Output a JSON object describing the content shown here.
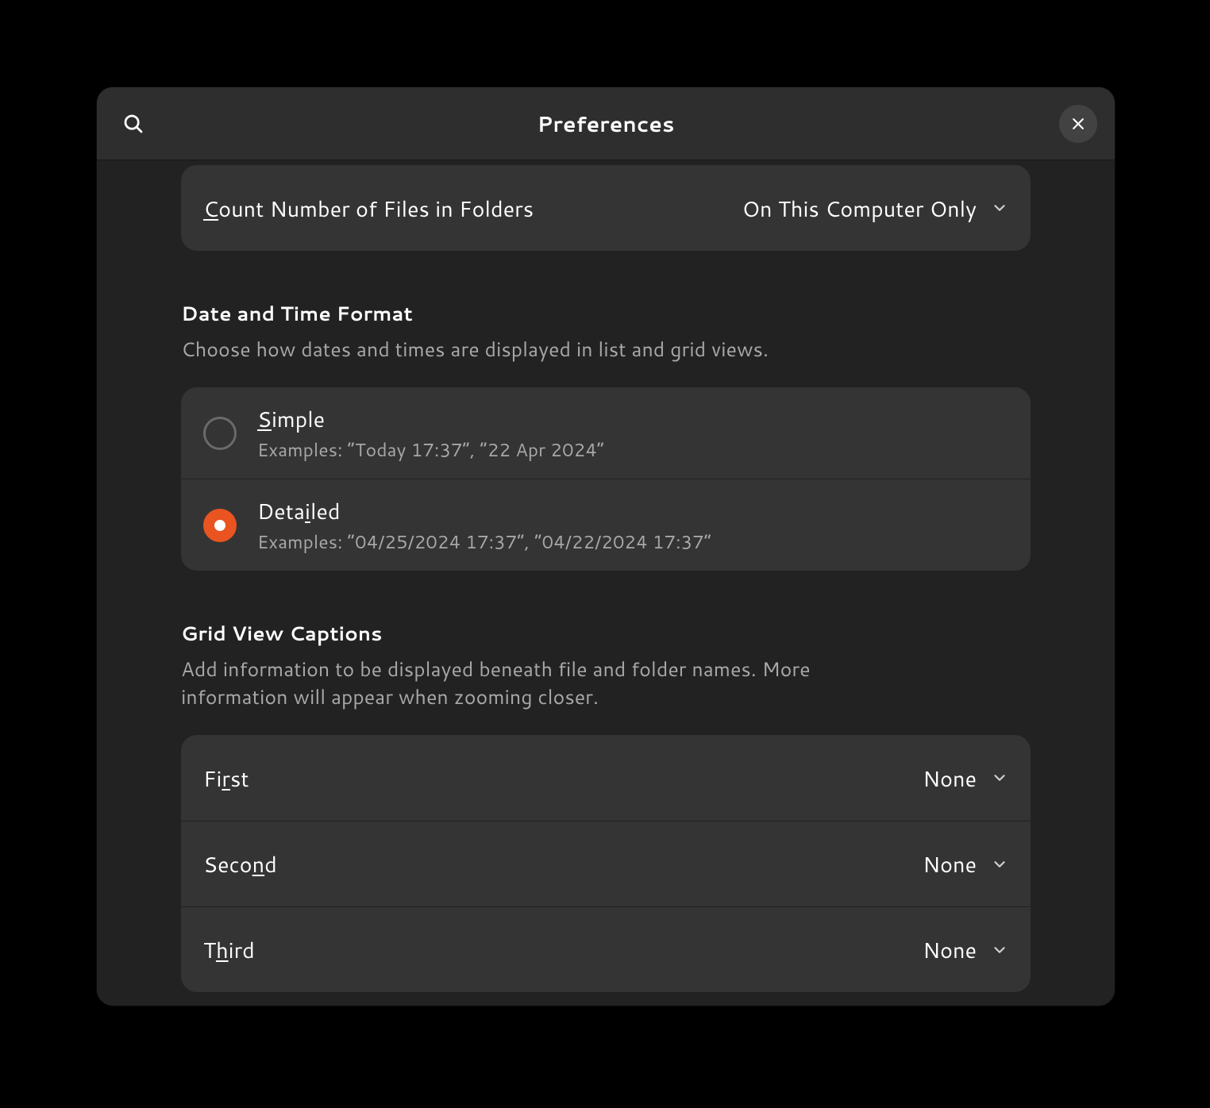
{
  "title": "Preferences",
  "countFiles": {
    "labelPre": "",
    "mnemonic": "C",
    "labelPost": "ount Number of Files in Folders",
    "value": "On This Computer Only"
  },
  "dateTime": {
    "heading": "Date and Time Format",
    "sub": "Choose how dates and times are displayed in list and grid views.",
    "simple": {
      "pre": "",
      "mnemonic": "S",
      "post": "imple",
      "sub": "Examples: “Today 17:37”, “22 Apr 2024”",
      "selected": false
    },
    "detailed": {
      "pre": "Deta",
      "mnemonic": "i",
      "post": "led",
      "sub": "Examples: “04/25/2024 17:37”, “04/22/2024 17:37”",
      "selected": true
    }
  },
  "gridCaptions": {
    "heading": "Grid View Captions",
    "sub": "Add information to be displayed beneath file and folder names. More information will appear when zooming closer.",
    "first": {
      "pre": "Fi",
      "mnemonic": "r",
      "post": "st",
      "value": "None"
    },
    "second": {
      "pre": "Seco",
      "mnemonic": "n",
      "post": "d",
      "value": "None"
    },
    "third": {
      "pre": "T",
      "mnemonic": "h",
      "post": "ird",
      "value": "None"
    }
  }
}
